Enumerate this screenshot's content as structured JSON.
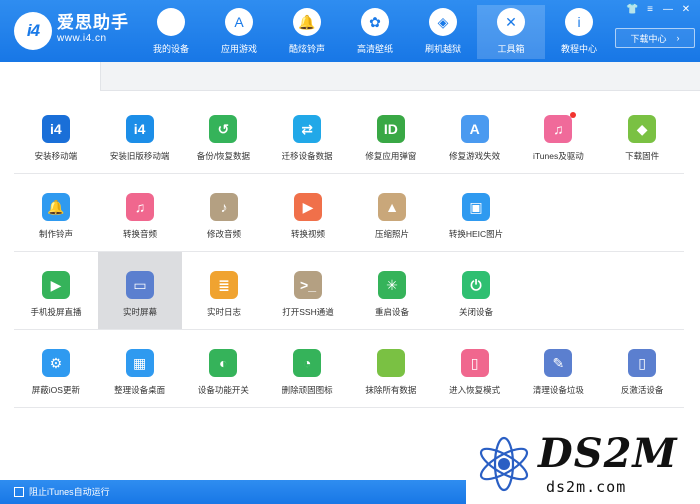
{
  "app": {
    "logo_mark": "i4",
    "name": "爱思助手",
    "url": "www.i4.cn"
  },
  "nav": [
    {
      "label": "我的设备",
      "icon": "apple-icon",
      "glyph": ""
    },
    {
      "label": "应用游戏",
      "icon": "app-store-icon",
      "glyph": "A"
    },
    {
      "label": "酷炫铃声",
      "icon": "bell-icon",
      "glyph": "🔔"
    },
    {
      "label": "高清壁纸",
      "icon": "flower-icon",
      "glyph": "✿"
    },
    {
      "label": "刷机越狱",
      "icon": "box-icon",
      "glyph": "◈"
    },
    {
      "label": "工具箱",
      "icon": "tools-icon",
      "glyph": "✕",
      "active": true
    },
    {
      "label": "教程中心",
      "icon": "info-icon",
      "glyph": "i"
    }
  ],
  "window_controls": {
    "shirt": "👕",
    "menu": "≡",
    "minimize": "—",
    "close": "✕"
  },
  "download_center": {
    "label": "下载中心",
    "arrow": "›"
  },
  "tools": [
    [
      {
        "label": "安装移动端",
        "icon": "i4-app-icon",
        "glyph": "i4",
        "color": "#1a6fd8"
      },
      {
        "label": "安装旧版移动端",
        "icon": "i4-legacy-app-icon",
        "glyph": "i4",
        "color": "#1c8ee8"
      },
      {
        "label": "备份/恢复数据",
        "icon": "backup-clock-icon",
        "glyph": "↺",
        "color": "#35b35a"
      },
      {
        "label": "迁移设备数据",
        "icon": "migrate-phones-icon",
        "glyph": "⇄",
        "color": "#21a8e8"
      },
      {
        "label": "修复应用弹窗",
        "icon": "apple-id-icon",
        "glyph": "ID",
        "color": "#39a845"
      },
      {
        "label": "修复游戏失效",
        "icon": "app-repair-icon",
        "glyph": "A",
        "color": "#4a9af0"
      },
      {
        "label": "iTunes及驱动",
        "icon": "itunes-icon",
        "glyph": "♫",
        "color": "#f06a9a",
        "dot": true
      },
      {
        "label": "下载固件",
        "icon": "firmware-cube-icon",
        "glyph": "◆",
        "color": "#7ac143"
      }
    ],
    [
      {
        "label": "制作铃声",
        "icon": "ringtone-bell-icon",
        "glyph": "🔔",
        "color": "#2f9af0"
      },
      {
        "label": "转换音频",
        "icon": "audio-convert-icon",
        "glyph": "♫",
        "color": "#f0678e"
      },
      {
        "label": "修改音频",
        "icon": "audio-edit-icon",
        "glyph": "♪",
        "color": "#b4a082"
      },
      {
        "label": "转换视频",
        "icon": "video-convert-icon",
        "glyph": "▶",
        "color": "#f0704a"
      },
      {
        "label": "压缩照片",
        "icon": "photo-compress-icon",
        "glyph": "▲",
        "color": "#c9a77a"
      },
      {
        "label": "转换HEIC图片",
        "icon": "heic-convert-icon",
        "glyph": "▣",
        "color": "#2f9af0"
      }
    ],
    [
      {
        "label": "手机投屏直播",
        "icon": "screen-cast-icon",
        "glyph": "▶",
        "color": "#35b35a"
      },
      {
        "label": "实时屏幕",
        "icon": "live-screen-icon",
        "glyph": "▭",
        "color": "#5b7fcf",
        "selected": true
      },
      {
        "label": "实时日志",
        "icon": "live-log-icon",
        "glyph": "≣",
        "color": "#f0a330"
      },
      {
        "label": "打开SSH通道",
        "icon": "ssh-terminal-icon",
        "glyph": ">_",
        "color": "#b4a082"
      },
      {
        "label": "重启设备",
        "icon": "reboot-icon",
        "glyph": "✳",
        "color": "#35b35a"
      },
      {
        "label": "关闭设备",
        "icon": "power-icon",
        "glyph": "⏻",
        "color": "#2fbf71"
      }
    ],
    [
      {
        "label": "屏蔽iOS更新",
        "icon": "block-update-gear-icon",
        "glyph": "⚙",
        "color": "#2f9af0"
      },
      {
        "label": "整理设备桌面",
        "icon": "desktop-grid-icon",
        "glyph": "▦",
        "color": "#2f9af0"
      },
      {
        "label": "设备功能开关",
        "icon": "feature-toggle-icon",
        "glyph": "◐",
        "color": "#35b35a"
      },
      {
        "label": "删除顽固图标",
        "icon": "delete-icon-pie-icon",
        "glyph": "◔",
        "color": "#35b35a"
      },
      {
        "label": "抹除所有数据",
        "icon": "erase-apple-icon",
        "glyph": "",
        "color": "#7ac143"
      },
      {
        "label": "进入恢复模式",
        "icon": "recovery-mode-icon",
        "glyph": "▯",
        "color": "#f0678e"
      },
      {
        "label": "清理设备垃圾",
        "icon": "cleanup-brush-icon",
        "glyph": "✎",
        "color": "#5b7fcf"
      },
      {
        "label": "反激活设备",
        "icon": "deactivate-phone-icon",
        "glyph": "▯",
        "color": "#5b7fcf"
      }
    ]
  ],
  "status": {
    "itunes_block_label": "阻止iTunes自动运行"
  },
  "watermark": {
    "big": "DS2M",
    "small": "ds2m.com"
  }
}
